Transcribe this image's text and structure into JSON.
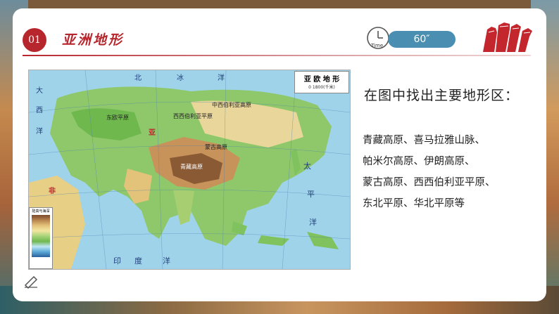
{
  "section": {
    "number": "01",
    "title": "亚洲地形"
  },
  "timer": {
    "clock_label": "Time",
    "value": "60″"
  },
  "map": {
    "legend_title": "亚 欧 地 形",
    "scale_text": "0        1800(千米)",
    "elevation_title": "陆高与海深",
    "labels": [
      "北",
      "冰",
      "洋",
      "大",
      "西",
      "洋",
      "东欧平原",
      "西西伯利亚平原",
      "中西伯利亚高原",
      "亚",
      "蒙古高原",
      "青藏高原",
      "太",
      "平",
      "洋",
      "印",
      "度",
      "洋",
      "非"
    ]
  },
  "question": "在图中找出主要地形区：",
  "answer_lines": [
    "青藏高原、喜马拉雅山脉、",
    "帕米尔高原、伊朗高原、",
    "蒙古高原、西西伯利亚平原、",
    "东北平原、华北平原等"
  ],
  "colors": {
    "accent": "#b8262d",
    "timer_bg": "#4a8fb1"
  },
  "icons": {
    "clock": "clock-icon",
    "fists": "raised-fists-icon",
    "pencil": "pencil-icon"
  }
}
